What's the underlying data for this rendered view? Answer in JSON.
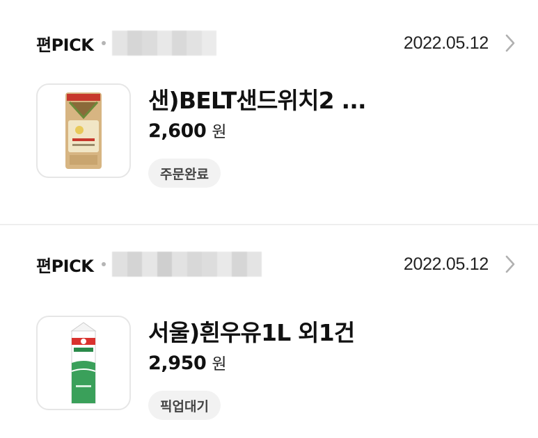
{
  "orders": [
    {
      "service": "편PICK",
      "date": "2022.05.12",
      "product_name": "샌)BELT샌드위치2 ...",
      "price": "2,600",
      "currency_unit": "원",
      "status": "주문완료",
      "thumbnail_icon": "sandwich-icon"
    },
    {
      "service": "편PICK",
      "date": "2022.05.12",
      "product_name": "서울)흰우유1L 외1건",
      "price": "2,950",
      "currency_unit": "원",
      "status": "픽업대기",
      "thumbnail_icon": "milk-carton-icon"
    }
  ],
  "colors": {
    "badge_bg": "#f2f2f2",
    "divider": "#eeeeee",
    "chevron": "#b0b0b0"
  }
}
